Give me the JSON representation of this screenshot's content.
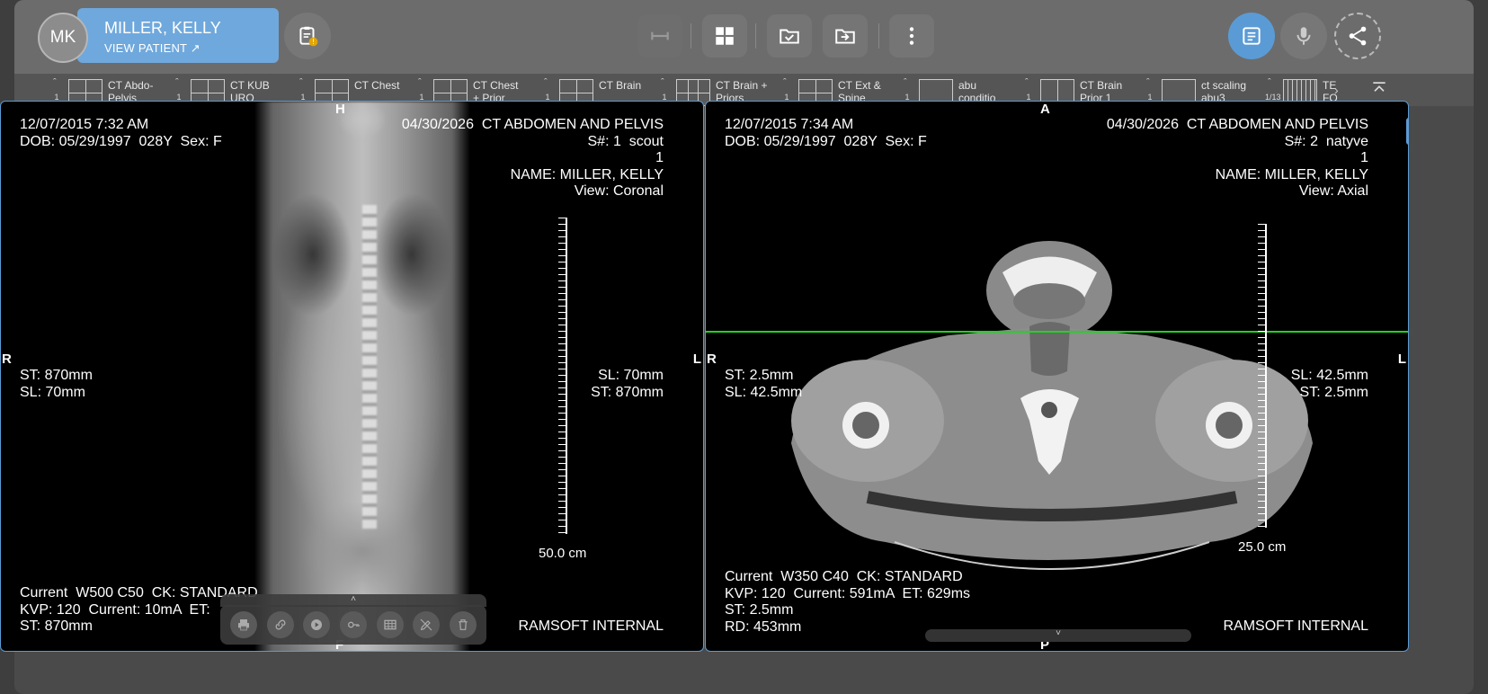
{
  "header": {
    "avatar_initials": "MK",
    "patient_name": "MILLER, KELLY",
    "view_patient": "VIEW PATIENT ↗",
    "collapse_icon": "chevron-up-icon"
  },
  "thumbnails": [
    {
      "count": "1",
      "label": "CT Abdo-\nPelvis",
      "grid": "g4"
    },
    {
      "count": "1",
      "label": "CT KUB\nURO",
      "grid": "g4"
    },
    {
      "count": "1",
      "label": "CT Chest",
      "grid": "g4"
    },
    {
      "count": "1",
      "label": "CT Chest\n+ Prior",
      "grid": "g4"
    },
    {
      "count": "1",
      "label": "CT Brain",
      "grid": "g4"
    },
    {
      "count": "1",
      "label": "CT Brain +\nPriors",
      "grid": "g6"
    },
    {
      "count": "1",
      "label": "CT Ext &\nSpine",
      "grid": "g4"
    },
    {
      "count": "1",
      "label": "abu\nconditio",
      "grid": ""
    },
    {
      "count": "1",
      "label": "CT Brain\nPrior 1",
      "grid": "g2"
    },
    {
      "count": "1",
      "label": "ct scaling\nabu3",
      "grid": ""
    },
    {
      "count": "1/13",
      "label": "TE\nFO",
      "grid": "gstripe"
    }
  ],
  "viewport1": {
    "top_left": "12/07/2015 7:32 AM\nDOB: 05/29/1997  028Y  Sex: F",
    "top_right": "04/30/2026  CT ABDOMEN AND PELVIS\nS#: 1  scout\n1\nNAME: MILLER, KELLY\nView: Coronal",
    "mid_left": "ST: 870mm\nSL: 70mm",
    "mid_right": "SL: 70mm\nST: 870mm",
    "bottom_left": "Current  W500 C50  CK: STANDARD\nKVP: 120  Current: 10mA  ET:\nST: 870mm",
    "bottom_right": "RAMSOFT INTERNAL",
    "scale": "50.0 cm",
    "orient_top": "H",
    "orient_left": "R",
    "orient_right": "L",
    "orient_bottom": "F"
  },
  "viewport2": {
    "top_left": "12/07/2015 7:34 AM\nDOB: 05/29/1997  028Y  Sex: F",
    "top_right": "04/30/2026  CT ABDOMEN AND PELVIS\nS#: 2  natyve\n1\nNAME: MILLER, KELLY\nView: Axial",
    "mid_left": "ST: 2.5mm\nSL: 42.5mm",
    "mid_right": "SL: 42.5mm\nST: 2.5mm",
    "bottom_left": "Current  W350 C40  CK: STANDARD\nKVP: 120  Current: 591mA  ET: 629ms\nST: 2.5mm\nRD: 453mm",
    "bottom_right": "RAMSOFT INTERNAL",
    "scale": "25.0 cm",
    "orient_top": "A",
    "orient_left": "R",
    "orient_right": "L",
    "orient_bottom": "P"
  },
  "colors": {
    "accent": "#5b9bd5",
    "crossline": "#1fd31f"
  }
}
